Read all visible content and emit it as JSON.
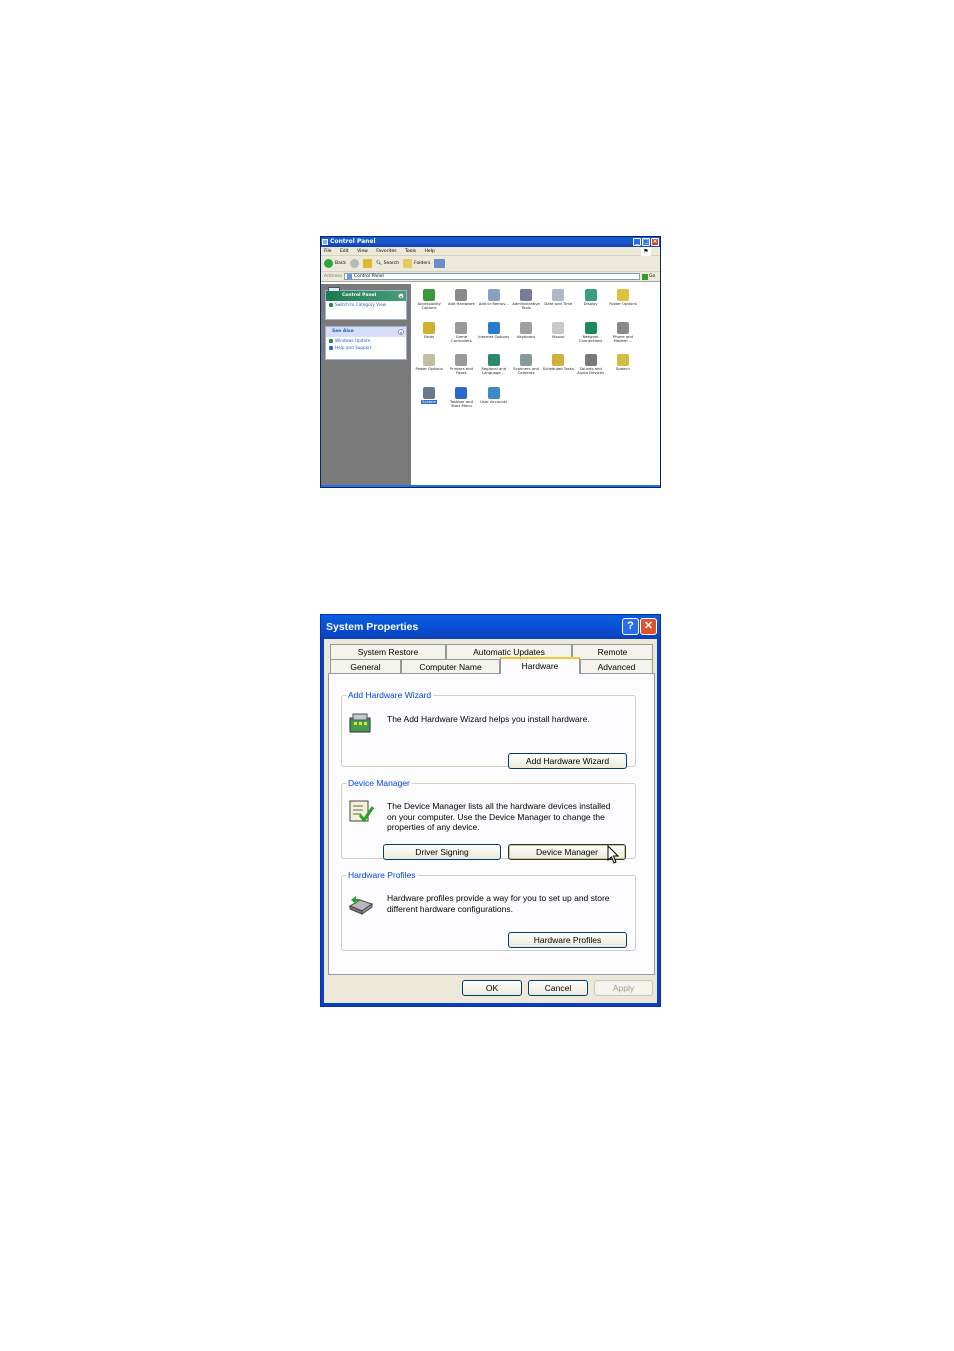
{
  "control_panel": {
    "title": "Control Panel",
    "menu": [
      "File",
      "Edit",
      "View",
      "Favorites",
      "Tools",
      "Help"
    ],
    "toolbar": {
      "back": "Back",
      "search": "Search",
      "folders": "Folders"
    },
    "address": {
      "label": "Address",
      "value": "Control Panel",
      "go": "Go"
    },
    "sidebar": {
      "panel_title": "Control Panel",
      "switch_view": "Switch to Category View",
      "see_also_title": "See Also",
      "see_also": [
        "Windows Update",
        "Help and Support"
      ]
    },
    "items": [
      {
        "label": "Accessibility Options",
        "color": "#3a9a3a"
      },
      {
        "label": "Add Hardware",
        "color": "#8a8a8a"
      },
      {
        "label": "Add or Remov...",
        "color": "#8aa0c0"
      },
      {
        "label": "Administrative Tools",
        "color": "#7a7a9a"
      },
      {
        "label": "Date and Time",
        "color": "#b0b8c8"
      },
      {
        "label": "Display",
        "color": "#3aa07a"
      },
      {
        "label": "Folder Options",
        "color": "#e0c040"
      },
      {
        "label": "Fonts",
        "color": "#d0b030"
      },
      {
        "label": "Game Controllers",
        "color": "#9a9a9a"
      },
      {
        "label": "Internet Options",
        "color": "#2a7ad0"
      },
      {
        "label": "Keyboard",
        "color": "#a0a0a0"
      },
      {
        "label": "Mouse",
        "color": "#c8c8c8"
      },
      {
        "label": "Network Connections",
        "color": "#1a8a5a"
      },
      {
        "label": "Phone and Modem ...",
        "color": "#8a8a8a"
      },
      {
        "label": "Power Options",
        "color": "#c0c0a0"
      },
      {
        "label": "Printers and Faxes",
        "color": "#9a9a9a"
      },
      {
        "label": "Regional and Language ...",
        "color": "#2a8a6a"
      },
      {
        "label": "Scanners and Cameras",
        "color": "#8a9a9a"
      },
      {
        "label": "Scheduled Tasks",
        "color": "#d0b040"
      },
      {
        "label": "Sounds and Audio Devices",
        "color": "#7a7a7a"
      },
      {
        "label": "Speech",
        "color": "#d0c040"
      },
      {
        "label": "System",
        "color": "#6a7a8a",
        "selected": true
      },
      {
        "label": "Taskbar and Start Menu",
        "color": "#2a6ad0"
      },
      {
        "label": "User Accounts",
        "color": "#3a8aca"
      }
    ]
  },
  "system_properties": {
    "title": "System Properties",
    "tabs_top": [
      "System Restore",
      "Automatic Updates",
      "Remote"
    ],
    "tabs_bottom": [
      "General",
      "Computer Name",
      "Hardware",
      "Advanced"
    ],
    "active_tab": "Hardware",
    "add_hw": {
      "legend": "Add Hardware Wizard",
      "text": "The Add Hardware Wizard helps you install hardware.",
      "button": "Add Hardware Wizard"
    },
    "dev_mgr": {
      "legend": "Device Manager",
      "text": "The Device Manager lists all the hardware devices installed on your computer. Use the Device Manager to change the properties of any device.",
      "btn_signing": "Driver Signing",
      "btn_manager": "Device Manager"
    },
    "hw_profiles": {
      "legend": "Hardware Profiles",
      "text": "Hardware profiles provide a way for you to set up and store different hardware configurations.",
      "button": "Hardware Profiles"
    },
    "ok": "OK",
    "cancel": "Cancel",
    "apply": "Apply"
  }
}
